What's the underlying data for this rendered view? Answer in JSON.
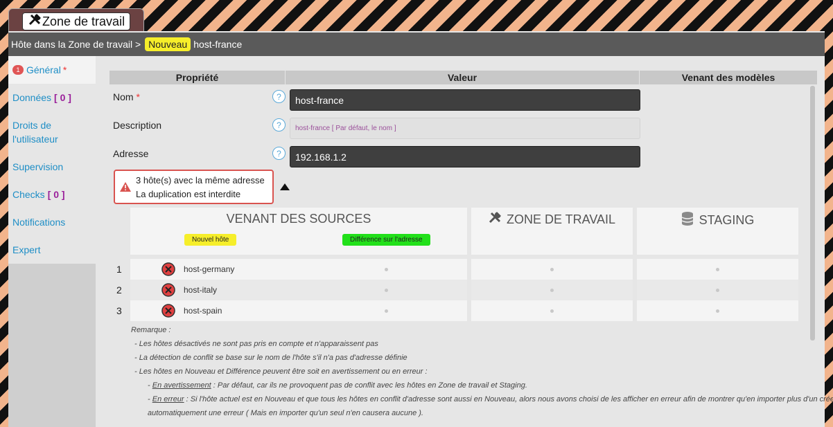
{
  "tab": {
    "label": "Zone de travail",
    "icon": "tools-icon"
  },
  "breadcrumb": {
    "prefix": "Hôte dans la Zone de travail >",
    "badge": "Nouveau",
    "host": "host-france"
  },
  "sidebar": {
    "items": [
      {
        "num": "1",
        "label": "Général",
        "required": "*"
      },
      {
        "label": "Données",
        "count": "[ 0 ]"
      },
      {
        "label": "Droits de l'utilisateur"
      },
      {
        "label": "Supervision"
      },
      {
        "label": "Checks",
        "count": "[ 0 ]"
      },
      {
        "label": "Notifications"
      },
      {
        "label": "Expert"
      }
    ]
  },
  "table": {
    "headers": [
      "Propriété",
      "Valeur",
      "Venant des modèles"
    ]
  },
  "form": {
    "nom": {
      "label": "Nom",
      "required": "*",
      "value": "host-france"
    },
    "description": {
      "label": "Description",
      "placeholder": "host-france [ Par défaut, le nom ]"
    },
    "adresse": {
      "label": "Adresse",
      "value": "192.168.1.2"
    },
    "help": "?"
  },
  "alert": {
    "line1": "3 hôte(s) avec la même adresse",
    "line2": "La duplication est interdite",
    "color": "#d9534f"
  },
  "conflicts": {
    "panels": {
      "sources": "VENANT DES SOURCES",
      "workzone": "ZONE DE TRAVAIL",
      "staging": "STAGING"
    },
    "pills": {
      "new_host": {
        "label": "Nouvel hôte",
        "color": "#f6ee2a"
      },
      "address_diff": {
        "label": "Différence sur l'adresse",
        "color": "#22e01a"
      }
    },
    "rows": [
      {
        "num": "1",
        "host": "host-germany"
      },
      {
        "num": "2",
        "host": "host-italy"
      },
      {
        "num": "3",
        "host": "host-spain"
      }
    ]
  },
  "notes": {
    "title": "Remarque :",
    "l1": "- Les hôtes désactivés ne sont pas pris en compte et n'apparaissent pas",
    "l2": "- La détection de conflit se base sur le nom de l'hôte s'il n'a pas d'adresse définie",
    "l3": "- Les hôtes en Nouveau et Différence peuvent être soit en avertissement ou en erreur :",
    "warn_term": "En avertissement",
    "warn_text": " : Par défaut, car ils ne provoquent pas de conflit avec les hôtes en Zone de travail et Staging.",
    "err_term": "En erreur",
    "err_text": " : Si l'hôte actuel est en Nouveau et que tous les hôtes en conflit d'adresse sont aussi en Nouveau, alors nous avons choisi de les afficher en erreur afin de montrer qu'en importer plus d'un créera",
    "err_text2": "automatiquement une erreur ( Mais en importer qu'un seul n'en causera aucune )."
  }
}
